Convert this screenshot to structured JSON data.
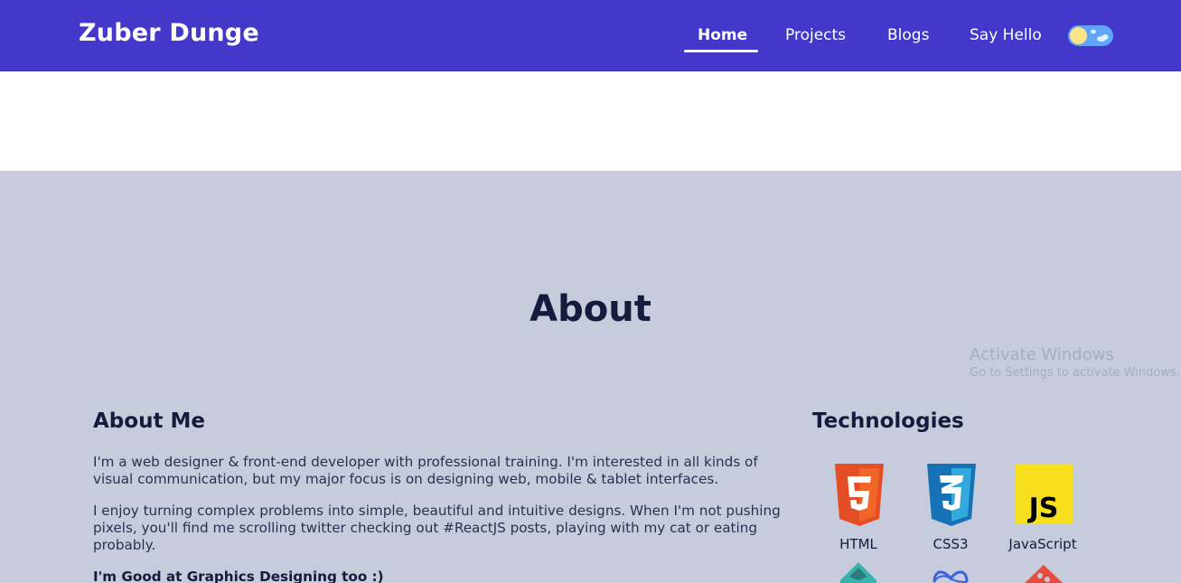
{
  "header": {
    "brand": "Zuber Dunge",
    "nav": [
      {
        "label": "Home",
        "active": true
      },
      {
        "label": "Projects"
      },
      {
        "label": "Blogs"
      },
      {
        "label": "Say Hello"
      }
    ],
    "theme_toggle": "sun-cloud-icon"
  },
  "about": {
    "title": "About",
    "about_me": {
      "heading": "About Me",
      "paragraph1": "I'm a web designer & front-end developer with professional training. I'm interested in all kinds of visual communication, but my major focus is on designing web, mobile & tablet interfaces.",
      "paragraph2": "I enjoy turning complex problems into simple, beautiful and intuitive designs. When I'm not pushing pixels, you'll find me scrolling twitter checking out #ReactJS posts, playing with my cat or eating probably.",
      "paragraph3": "I'm Good at Graphics Designing too :)"
    },
    "technologies": {
      "heading": "Technologies",
      "items": [
        {
          "label": "HTML",
          "icon": "html5-icon"
        },
        {
          "label": "CSS3",
          "icon": "css3-icon"
        },
        {
          "label": "JavaScript",
          "icon": "javascript-icon"
        }
      ],
      "partial_icons": [
        "bootstrap-icon",
        "meta-icon",
        "git-icon"
      ]
    }
  },
  "watermark": {
    "line1": "Activate Windows",
    "line2": "Go to Settings to activate Windows."
  },
  "colors": {
    "nav_bg": "#4338ca",
    "section_bg": "#c6ccdb",
    "heading": "#161b3d",
    "html": "#e44d26",
    "css": "#1572b6",
    "js": "#f7df1e"
  }
}
